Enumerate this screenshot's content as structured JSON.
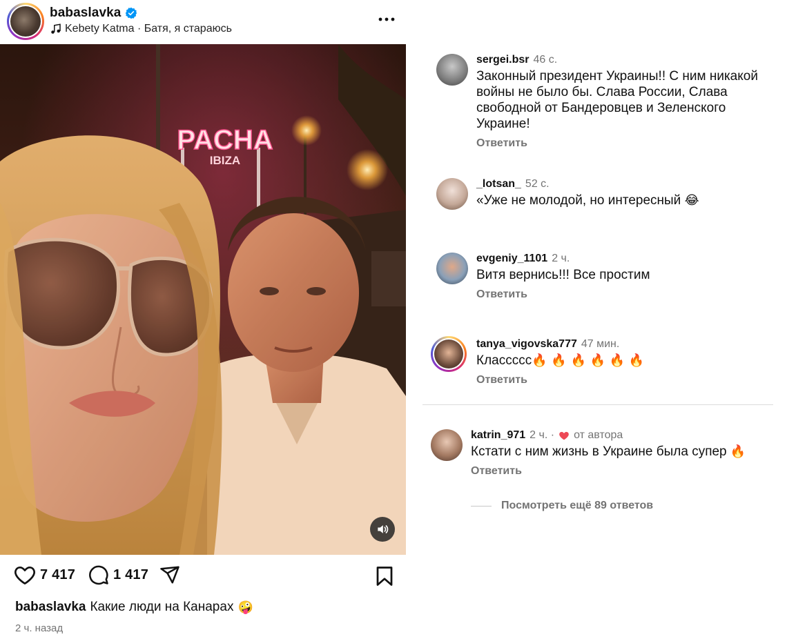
{
  "post": {
    "username": "babaslavka",
    "music": "Kebety Katma · Батя, я стараюсь",
    "sign_text": "PACHA",
    "sign_subtext": "IBIZA",
    "likes": "7 417",
    "comments_count": "1 417",
    "caption": "Какие люди на Канарах",
    "caption_emoji": "🤪",
    "time": "2 ч. назад"
  },
  "comments": [
    {
      "user": "sergei.bsr",
      "time": "46 с.",
      "text": "Законный президент Украины!! С ним никакой войны не было бы. Слава России, Слава свободной от Бандеровцев и Зеленского Украине!",
      "reply": "Ответить"
    },
    {
      "user": "_lotsan_",
      "time": "52 с.",
      "text": "«Уже не молодой, но интересный",
      "emoji": "😂"
    },
    {
      "user": "evgeniy_1101",
      "time": "2 ч.",
      "text": "Витя вернись!!! Все простим",
      "reply": "Ответить"
    },
    {
      "user": "tanya_vigovska777",
      "time": "47 мин.",
      "text": "Классссс",
      "emoji": "🔥 🔥 🔥 🔥 🔥 🔥",
      "reply": "Ответить"
    },
    {
      "user": "katrin_971",
      "time": "2 ч. ·",
      "author_badge": "от автора",
      "text": "Кстати с ним жизнь в Украине была супер",
      "emoji": "🔥",
      "reply": "Ответить"
    }
  ],
  "view_more": "Посмотреть ещё 89 ответов",
  "colors": {
    "heart": "#ed4956",
    "verified": "#0095f6",
    "muted": "#737373"
  }
}
